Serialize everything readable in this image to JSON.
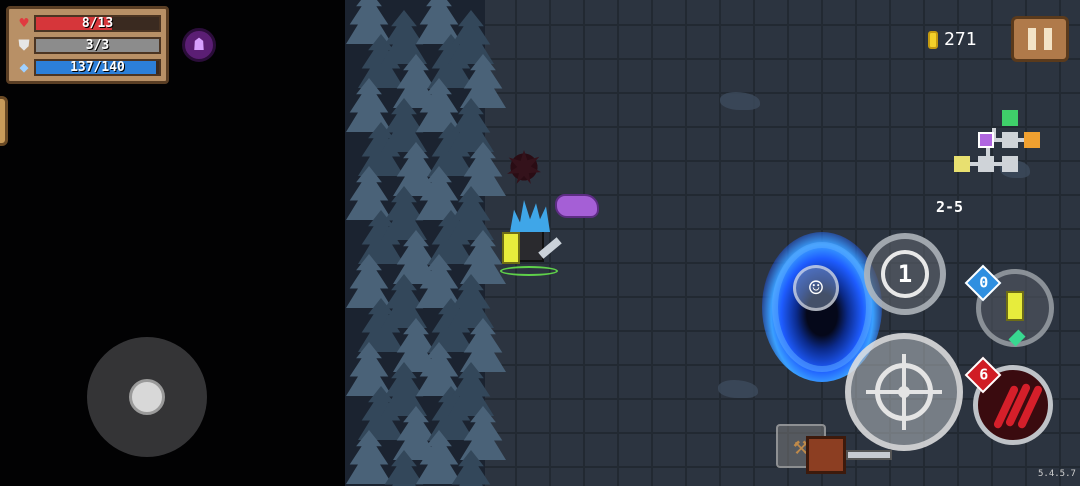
{
  "hud": {
    "health": {
      "text": "8/13",
      "value": 8,
      "max": 13,
      "color": "#d6363a",
      "icon": "heart-icon"
    },
    "armor": {
      "text": "3/3",
      "value": 3,
      "max": 3,
      "color": "#8c8c8c",
      "icon": "shield-icon"
    },
    "energy": {
      "text": "137/140",
      "value": 137,
      "max": 140,
      "color": "#2c7fd8",
      "icon": "diamond-icon"
    },
    "buff_icon": "demon-helmet-icon",
    "gold": "271",
    "level": "2-5",
    "version": "5.4.5.7"
  },
  "controls": {
    "skill_swap_label": "1",
    "weapon_energy_cost": "0",
    "character_skill_count": "6"
  },
  "colors": {
    "floor": "#2c3440",
    "portal": "#1e5cff",
    "panel": "#b89066"
  }
}
